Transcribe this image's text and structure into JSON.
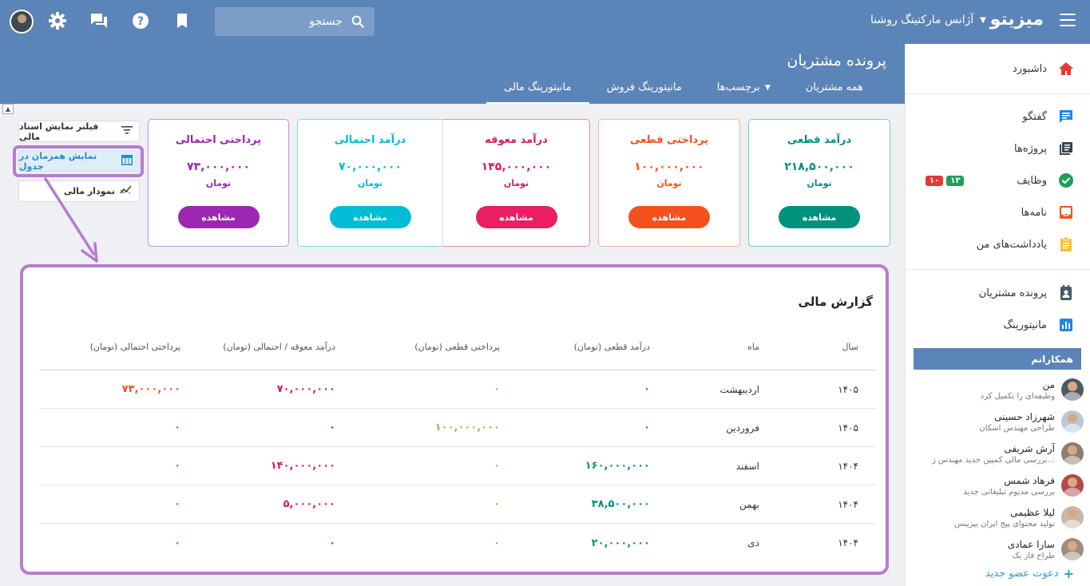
{
  "topbar": {
    "brand": "میزیتو",
    "workspace": "آژانس مارکتینگ روشنا",
    "search_placeholder": "جستجو",
    "icons": [
      "menu-icon",
      "search-icon",
      "bookmark-icon",
      "help-icon",
      "chat-icon",
      "gear-icon",
      "avatar"
    ]
  },
  "page": {
    "title": "پرونده مشتریان",
    "tabs": [
      {
        "label": "همه مشتریان",
        "active": false,
        "caret": false
      },
      {
        "label": "برچسب‌ها",
        "active": false,
        "caret": true
      },
      {
        "label": "مانیتورینگ فروش",
        "active": false,
        "caret": false
      },
      {
        "label": "مانیتورینگ مالی",
        "active": true,
        "caret": false
      }
    ]
  },
  "sidebar": {
    "items": [
      {
        "label": "داشبورد",
        "icon": "home-icon",
        "color": "#e53935"
      },
      {
        "label": "گفتگو",
        "icon": "chat-icon",
        "color": "#1e88e5"
      },
      {
        "label": "پروژه‌ها",
        "icon": "projects-icon",
        "color": "#37474f"
      },
      {
        "label": "وظایف",
        "icon": "check-circle-icon",
        "color": "#1e9e5a"
      },
      {
        "label": "نامه‌ها",
        "icon": "inbox-icon",
        "color": "#f4511e"
      },
      {
        "label": "یادداشت‌های من",
        "icon": "note-icon",
        "color": "#fbc02d"
      },
      {
        "label": "پرونده مشتریان",
        "icon": "contact-icon",
        "color": "#455a64"
      },
      {
        "label": "مانیتورینگ",
        "icon": "chart-icon",
        "color": "#1e88e5"
      }
    ],
    "task_badges": [
      {
        "value": "۱۳",
        "color": "#1e9e5a"
      },
      {
        "value": "۱۰",
        "color": "#e53935"
      }
    ],
    "team_header": "همکارانم",
    "members": [
      {
        "name": "من",
        "sub": "وظیفه‌ای را تکمیل کرد",
        "color": "#4e5a60"
      },
      {
        "name": "شهرزاد حسینی",
        "sub": "طراحی مهندس اشکان",
        "color": "#b8c8d6"
      },
      {
        "name": "آرش شریفی",
        "sub": "بررسی مالی کمپین جدید مهندس ز...",
        "color": "#8c7d6e"
      },
      {
        "name": "فرهاد شمس",
        "sub": "بررسی مدیوم تبلیغاتی جدید",
        "color": "#b34a4a"
      },
      {
        "name": "لیلا عظیمی",
        "sub": "تولید محتوای پیج ایران بیزینس",
        "color": "#c9b7a6"
      },
      {
        "name": "سارا عمادی",
        "sub": "طراح فاز یک",
        "color": "#9e8c7c"
      }
    ],
    "invite": "دعوت عضو جدید"
  },
  "actions": {
    "filter": "فیلتر نمایش اسناد مالی",
    "table_view": "نمایش همزمان در جدول",
    "chart_view": "نمودار مالی"
  },
  "cards": [
    {
      "title": "درآمد قطعی",
      "amount": "۲۱۸,۵۰۰,۰۰۰",
      "unit": "تومان",
      "button": "مشاهده",
      "color": "#00917c",
      "border": "#7cc9bd"
    },
    {
      "title": "پرداختی قطعی",
      "amount": "۱۰۰,۰۰۰,۰۰۰",
      "unit": "تومان",
      "button": "مشاهده",
      "color": "#f4511e",
      "border": "#f7b39b"
    },
    {
      "title": "درآمد معوقه",
      "amount": "۱۴۵,۰۰۰,۰۰۰",
      "unit": "تومان",
      "button": "مشاهده",
      "color": "#d81b60",
      "border": "#e88aaa"
    },
    {
      "title": "درآمد احتمالی",
      "amount": "۷۰,۰۰۰,۰۰۰",
      "unit": "تومان",
      "button": "مشاهده",
      "color": "#00bcd4",
      "border": "#7fd9e6"
    },
    {
      "title": "پرداختی احتمالی",
      "amount": "۷۳,۰۰۰,۰۰۰",
      "unit": "تومان",
      "button": "مشاهده",
      "color": "#9c27b0",
      "border": "#c892d6"
    }
  ],
  "report": {
    "title": "گزارش مالی",
    "headers": {
      "year": "سال",
      "month": "ماه",
      "revenue": "درآمد قطعی (تومان)",
      "payment": "پرداختی قطعی (تومان)",
      "due": "درآمد معوقه / احتمالی (تومان)",
      "possible_payment": "پرداختی احتمالی (تومان)"
    },
    "rows": [
      {
        "year": "۱۴۰۵",
        "month": "اردیبهشت",
        "revenue": "۰",
        "payment": "۰",
        "due": "۷۰,۰۰۰,۰۰۰",
        "possible_payment": "۷۳,۰۰۰,۰۰۰"
      },
      {
        "year": "۱۴۰۵",
        "month": "فروردین",
        "revenue": "۰",
        "payment": "۱۰۰,۰۰۰,۰۰۰",
        "due": "۰",
        "possible_payment": "۰"
      },
      {
        "year": "۱۴۰۴",
        "month": "اسفند",
        "revenue": "۱۶۰,۰۰۰,۰۰۰",
        "payment": "۰",
        "due": "۱۴۰,۰۰۰,۰۰۰",
        "possible_payment": "۰"
      },
      {
        "year": "۱۴۰۴",
        "month": "بهمن",
        "revenue": "۳۸,۵۰۰,۰۰۰",
        "payment": "۰",
        "due": "۵,۰۰۰,۰۰۰",
        "possible_payment": "۰"
      },
      {
        "year": "۱۴۰۴",
        "month": "دی",
        "revenue": "۲۰,۰۰۰,۰۰۰",
        "payment": "۰",
        "due": "۰",
        "possible_payment": "۰"
      }
    ],
    "colors": {
      "revenue": "#00917c",
      "payment": "#8bc34a",
      "due": "#d81b60",
      "possible_payment": "#f4511e"
    }
  }
}
